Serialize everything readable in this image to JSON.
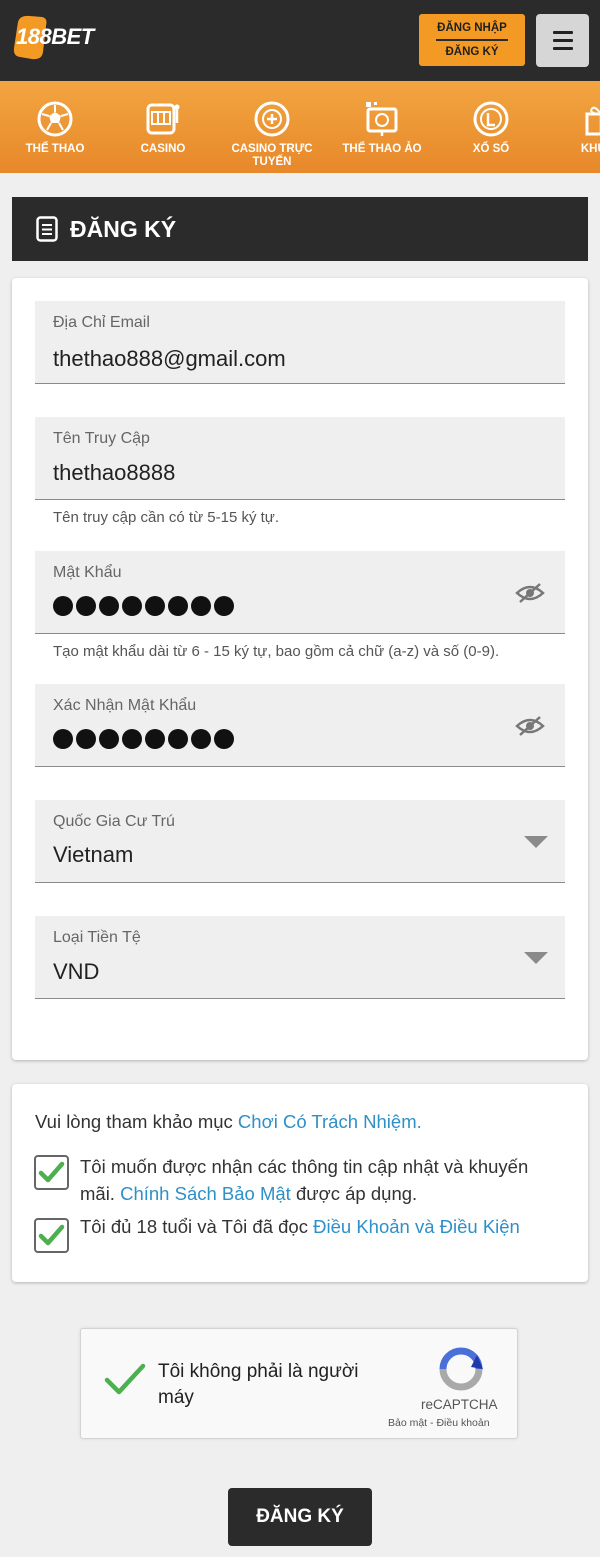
{
  "header": {
    "logo_text": "188BET",
    "login_label": "ĐĂNG NHẬP",
    "register_label": "ĐĂNG KÝ",
    "menu_icon": "hamburger-icon"
  },
  "nav": {
    "items": [
      {
        "label": "THỂ THAO",
        "icon": "soccer-ball-icon"
      },
      {
        "label": "CASINO",
        "icon": "slot-machine-icon"
      },
      {
        "label": "CASINO TRỰC TUYẾN",
        "icon": "casino-chip-icon"
      },
      {
        "label": "THỂ THAO ẢO",
        "icon": "virtual-sports-icon"
      },
      {
        "label": "XỔ SỐ",
        "icon": "lottery-ball-icon"
      },
      {
        "label": "KHUYẾ",
        "icon": "gift-icon"
      }
    ]
  },
  "section": {
    "title": "ĐĂNG KÝ",
    "icon": "document-icon"
  },
  "form": {
    "email": {
      "label": "Địa Chỉ Email",
      "value": "thethao888@gmail.com"
    },
    "username": {
      "label": "Tên Truy Cập",
      "value": "thethao8888",
      "hint": "Tên truy cập cần có từ 5-15 ký tự."
    },
    "password": {
      "label": "Mật Khẩu",
      "masked_length": 8,
      "hint": "Tạo mật khẩu dài từ 6 - 15 ký tự, bao gồm cả chữ (a-z) và số (0-9)."
    },
    "confirm_password": {
      "label": "Xác Nhận Mật Khẩu",
      "masked_length": 8
    },
    "country": {
      "label": "Quốc Gia Cư Trú",
      "value": "Vietnam"
    },
    "currency": {
      "label": "Loại Tiền Tệ",
      "value": "VND"
    }
  },
  "terms": {
    "intro": "Vui lòng tham khảo mục ",
    "intro_link": "Chơi Có Trách Nhiệm.",
    "promo_text": "Tôi muốn được nhận các thông tin cập nhật và khuyến mãi. ",
    "promo_link": "Chính Sách Bảo Mật",
    "promo_suffix": " được áp dụng.",
    "promo_checked": true,
    "age_text": "Tôi đủ 18 tuổi và Tôi đã đọc ",
    "age_link": "Điều Khoản và Điều Kiện",
    "age_checked": true
  },
  "captcha": {
    "text": "Tôi không phải là người máy",
    "brand": "reCAPTCHA",
    "privacy": "Bảo mật",
    "separator": " - ",
    "terms": "Điều khoản",
    "checked": true
  },
  "submit_label": "ĐĂNG KÝ",
  "colors": {
    "header_bg": "#2b2b2b",
    "accent_orange": "#f39a24",
    "link_blue": "#2f8fc7",
    "check_green": "#4caf50"
  }
}
